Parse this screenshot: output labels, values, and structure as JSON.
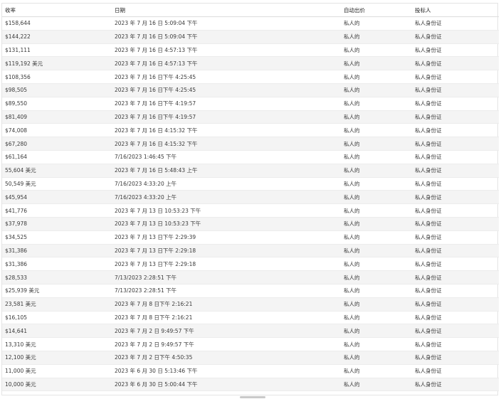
{
  "table": {
    "headers": [
      "收率",
      "日期",
      "自动出价",
      "投标人"
    ],
    "rows": [
      [
        "$158,644",
        "2023 年 7 月 16 日 5:09:04 下午",
        "私人的",
        "私人身份证"
      ],
      [
        "$144,222",
        "2023 年 7 月 16 日 5:09:04 下午",
        "私人的",
        "私人身份证"
      ],
      [
        "$131,111",
        "2023 年 7 月 16 日 4:57:13 下午",
        "私人的",
        "私人身份证"
      ],
      [
        "$119,192 美元",
        "2023 年 7 月 16 日 4:57:13 下午",
        "私人的",
        "私人身份证"
      ],
      [
        "$108,356",
        "2023 年 7 月 16 日下午 4:25:45",
        "私人的",
        "私人身份证"
      ],
      [
        "$98,505",
        "2023 年 7 月 16 日下午 4:25:45",
        "私人的",
        "私人身份证"
      ],
      [
        "$89,550",
        "2023 年 7 月 16 日下午 4:19:57",
        "私人的",
        "私人身份证"
      ],
      [
        "$81,409",
        "2023 年 7 月 16 日下午 4:19:57",
        "私人的",
        "私人身份证"
      ],
      [
        "$74,008",
        "2023 年 7 月 16 日 4:15:32 下午",
        "私人的",
        "私人身份证"
      ],
      [
        "$67,280",
        "2023 年 7 月 16 日 4:15:32 下午",
        "私人的",
        "私人身份证"
      ],
      [
        "$61,164",
        "7/16/2023 1:46:45 下午",
        "私人的",
        "私人身份证"
      ],
      [
        "55,604 美元",
        "2023 年 7 月 16 日 5:48:43 上午",
        "私人的",
        "私人身份证"
      ],
      [
        "50,549 美元",
        "7/16/2023 4:33:20 上午",
        "私人的",
        "私人身份证"
      ],
      [
        "$45,954",
        "7/16/2023 4:33:20 上午",
        "私人的",
        "私人身份证"
      ],
      [
        "$41,776",
        "2023 年 7 月 13 日 10:53:23 下午",
        "私人的",
        "私人身份证"
      ],
      [
        "$37,978",
        "2023 年 7 月 13 日 10:53:23 下午",
        "私人的",
        "私人身份证"
      ],
      [
        "$34,525",
        "2023 年 7 月 13 日下午 2:29:39",
        "私人的",
        "私人身份证"
      ],
      [
        "$31,386",
        "2023 年 7 月 13 日下午 2:29:18",
        "私人的",
        "私人身份证"
      ],
      [
        "$31,386",
        "2023 年 7 月 13 日下午 2:29:18",
        "私人的",
        "私人身份证"
      ],
      [
        "$28,533",
        "7/13/2023 2:28:51 下午",
        "私人的",
        "私人身份证"
      ],
      [
        "$25,939 美元",
        "7/13/2023 2:28:51 下午",
        "私人的",
        "私人身份证"
      ],
      [
        "23,581 美元",
        "2023 年 7 月 8 日下午 2:16:21",
        "私人的",
        "私人身份证"
      ],
      [
        "$16,105",
        "2023 年 7 月 8 日下午 2:16:21",
        "私人的",
        "私人身份证"
      ],
      [
        "$14,641",
        "2023 年 7 月 2 日 9:49:57 下午",
        "私人的",
        "私人身份证"
      ],
      [
        "13,310 美元",
        "2023 年 7 月 2 日 9:49:57 下午",
        "私人的",
        "私人身份证"
      ],
      [
        "12,100 美元",
        "2023 年 7 月 2 日下午 4:50:35",
        "私人的",
        "私人身份证"
      ],
      [
        "11,000 美元",
        "2023 年 6 月 30 日 5:13:46 下午",
        "私人的",
        "私人身份证"
      ],
      [
        "10,000 美元",
        "2023 年 6 月 30 日 5:00:44 下午",
        "私人的",
        "私人身份证"
      ]
    ]
  }
}
